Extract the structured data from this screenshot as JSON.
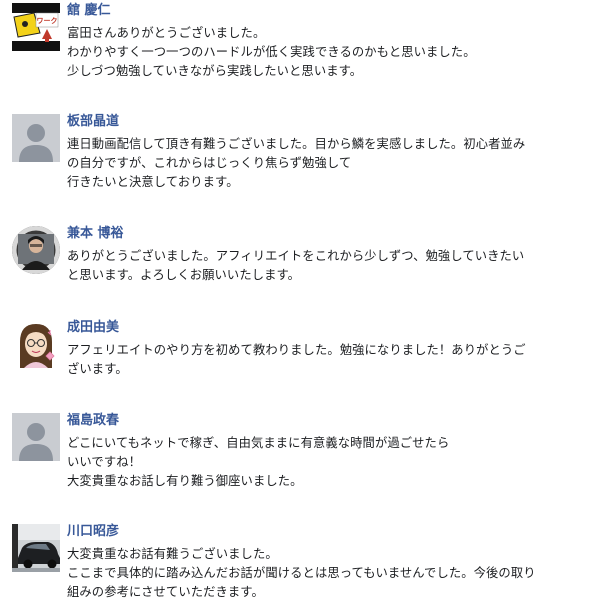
{
  "comments": [
    {
      "name": "舘 慶仁",
      "avatar_icon": "logo-avatar-icon",
      "lines": [
        "富田さんありがとうございました。",
        "わかりやすく一つ一つのハードルが低く実践できるのかもと思いました。",
        "少しづつ勉強していきながら実践したいと思います。"
      ]
    },
    {
      "name": "板部晶道",
      "avatar_icon": "default-user-icon",
      "lines": [
        "連日動画配信して頂き有難うございました。目から鱗を実感しました。初心者並み",
        "の自分ですが、これからはじっくり焦らず勉強して",
        "行きたいと決意しております。"
      ]
    },
    {
      "name": "兼本 博裕",
      "avatar_icon": "photo-avatar-icon",
      "lines": [
        "ありがとうございました。アフィリエイトをこれから少しずつ、勉強していきたい",
        "と思います。よろしくお願いいたします。"
      ]
    },
    {
      "name": "成田由美",
      "avatar_icon": "illustration-avatar-icon",
      "lines": [
        "アフェリエイトのやり方を初めて教わりました。勉強になりました！ありがとうご",
        "ざいます。"
      ]
    },
    {
      "name": "福島政春",
      "avatar_icon": "default-user-icon",
      "lines": [
        "どこにいてもネットで稼ぎ、自由気ままに有意義な時間が過ごせたら",
        "いいですね！",
        "大変貴重なお話し有り難う御座いました。"
      ]
    },
    {
      "name": "川口昭彦",
      "avatar_icon": "car-photo-avatar-icon",
      "lines": [
        "大変貴重なお話有難うございました。",
        "ここまで具体的に踏み込んだお話が聞けるとは思ってもいませんでした。今後の取り",
        "組みの参考にさせていただきます。"
      ]
    }
  ],
  "colors": {
    "name_link": "#385898",
    "text": "#1c1e21",
    "default_avatar_bg": "#c9ccd1",
    "default_avatar_fg": "#8d949e"
  }
}
